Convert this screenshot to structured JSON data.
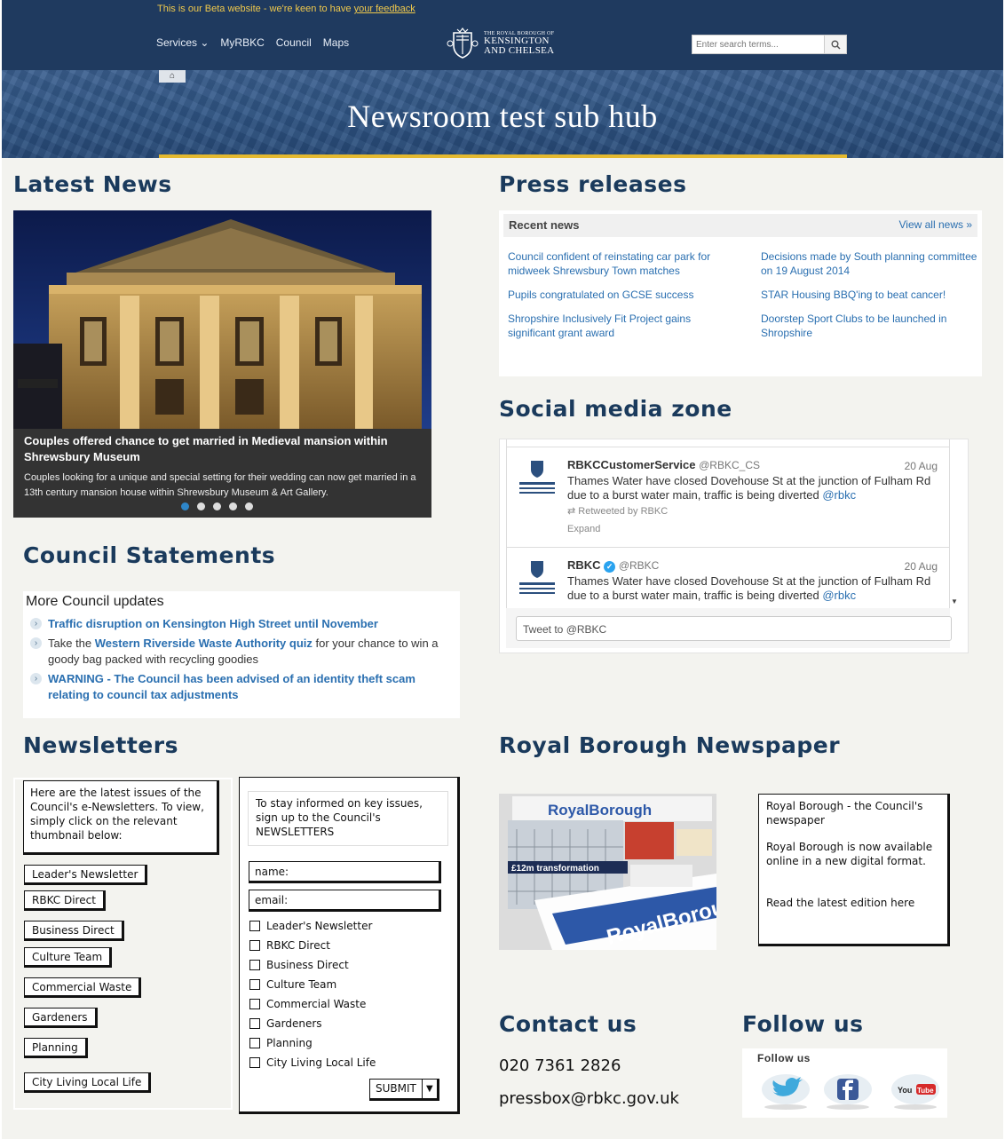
{
  "beta_bar": {
    "text": "This is our Beta website - we're keen to have ",
    "link": "your feedback"
  },
  "nav": {
    "services": "Services",
    "myrbkc": "MyRBKC",
    "council": "Council",
    "maps": "Maps"
  },
  "logo": {
    "small": "THE ROYAL BOROUGH OF",
    "line1": "KENSINGTON",
    "line2": "AND CHELSEA"
  },
  "search": {
    "placeholder": "Enter search terms..."
  },
  "breadcrumb": {
    "home_icon": "home-icon"
  },
  "hub_title": "Newsroom test sub hub",
  "sections": {
    "latest_news": "Latest News",
    "press_releases": "Press releases",
    "social": "Social media zone",
    "council_statements": "Council Statements",
    "newsletters": "Newsletters",
    "newspaper": "Royal Borough Newspaper",
    "contact": "Contact us",
    "follow": "Follow us"
  },
  "carousel": {
    "title": "Couples offered chance to get married in Medieval mansion within Shrewsbury Museum",
    "desc": "Couples looking for a unique and special setting for their wedding can now get married in a 13th century mansion house within Shrewsbury Museum & Art Gallery.",
    "slides": 5,
    "active": 1
  },
  "press": {
    "header": "Recent news",
    "view_all": "View all news »",
    "links": [
      "Council confident of reinstating car park for midweek Shrewsbury Town matches",
      "Decisions made by South planning committee on 19 August 2014",
      "Pupils congratulated on GCSE success",
      "STAR Housing BBQ'ing to beat cancer!",
      "Shropshire Inclusively Fit Project gains significant grant award",
      "Doorstep Sport Clubs to be launched in Shropshire"
    ]
  },
  "tweets": [
    {
      "name": "RBKCCustomerService",
      "handle": "@RBKC_CS",
      "date": "20 Aug",
      "text": "Thames Water have closed Dovehouse St at the junction of Fulham Rd due to a burst water main, traffic is being diverted ",
      "mention": "@rbkc",
      "retweet": "Retweeted by RBKC",
      "expand": "Expand"
    },
    {
      "name": "RBKC",
      "handle": "@RBKC",
      "date": "20 Aug",
      "text": "Thames Water have closed Dovehouse St at the junction of Fulham Rd due to a burst water main, traffic is being diverted ",
      "mention": "@rbkc"
    }
  ],
  "tweet_compose": "Tweet to @RBKC",
  "council": {
    "header": "More Council updates",
    "item1": "Traffic disruption on Kensington High Street until November",
    "item2_pre": "Take the ",
    "item2_link": "Western Riverside Waste Authority quiz",
    "item2_post": " for your chance to win a goody bag packed with recycling goodies",
    "item3": "WARNING - The Council has been advised of an identity theft scam relating to council tax adjustments"
  },
  "newsletters": {
    "intro": "Here are the latest issues of the Council's e-Newsletters. To view, simply click on the relevant thumbnail below:",
    "buttons": [
      "Leader's Newsletter",
      "RBKC Direct",
      "Business Direct",
      "Culture Team",
      "Commercial Waste",
      "Gardeners",
      "Planning",
      "City Living Local Life"
    ],
    "info": "To stay informed on key issues, sign up to the Council's NEWSLETTERS",
    "name_field": "name:",
    "email_field": "email:",
    "checkboxes": [
      "Leader's Newsletter",
      "RBKC Direct",
      "Business Direct",
      "Culture Team",
      "Commercial Waste",
      "Gardeners",
      "Planning",
      "City Living Local Life"
    ],
    "submit": "SUBMIT"
  },
  "newspaper": {
    "masthead": "RoyalBorough",
    "headline": "£12m transformation",
    "p1": "Royal Borough - the Council's newspaper",
    "p2": "Royal Borough is now available online in a new digital format.",
    "p3": "Read the latest edition here"
  },
  "contact": {
    "phone": "020 7361 2826",
    "email": "pressbox@rbkc.gov.uk"
  },
  "follow": {
    "label": "Follow us",
    "youtube": "YouTube"
  },
  "colors": {
    "header": "#1f3a5f",
    "accent": "#e4b92f",
    "heading": "#1a3a5c",
    "link": "#2a6fb0"
  }
}
